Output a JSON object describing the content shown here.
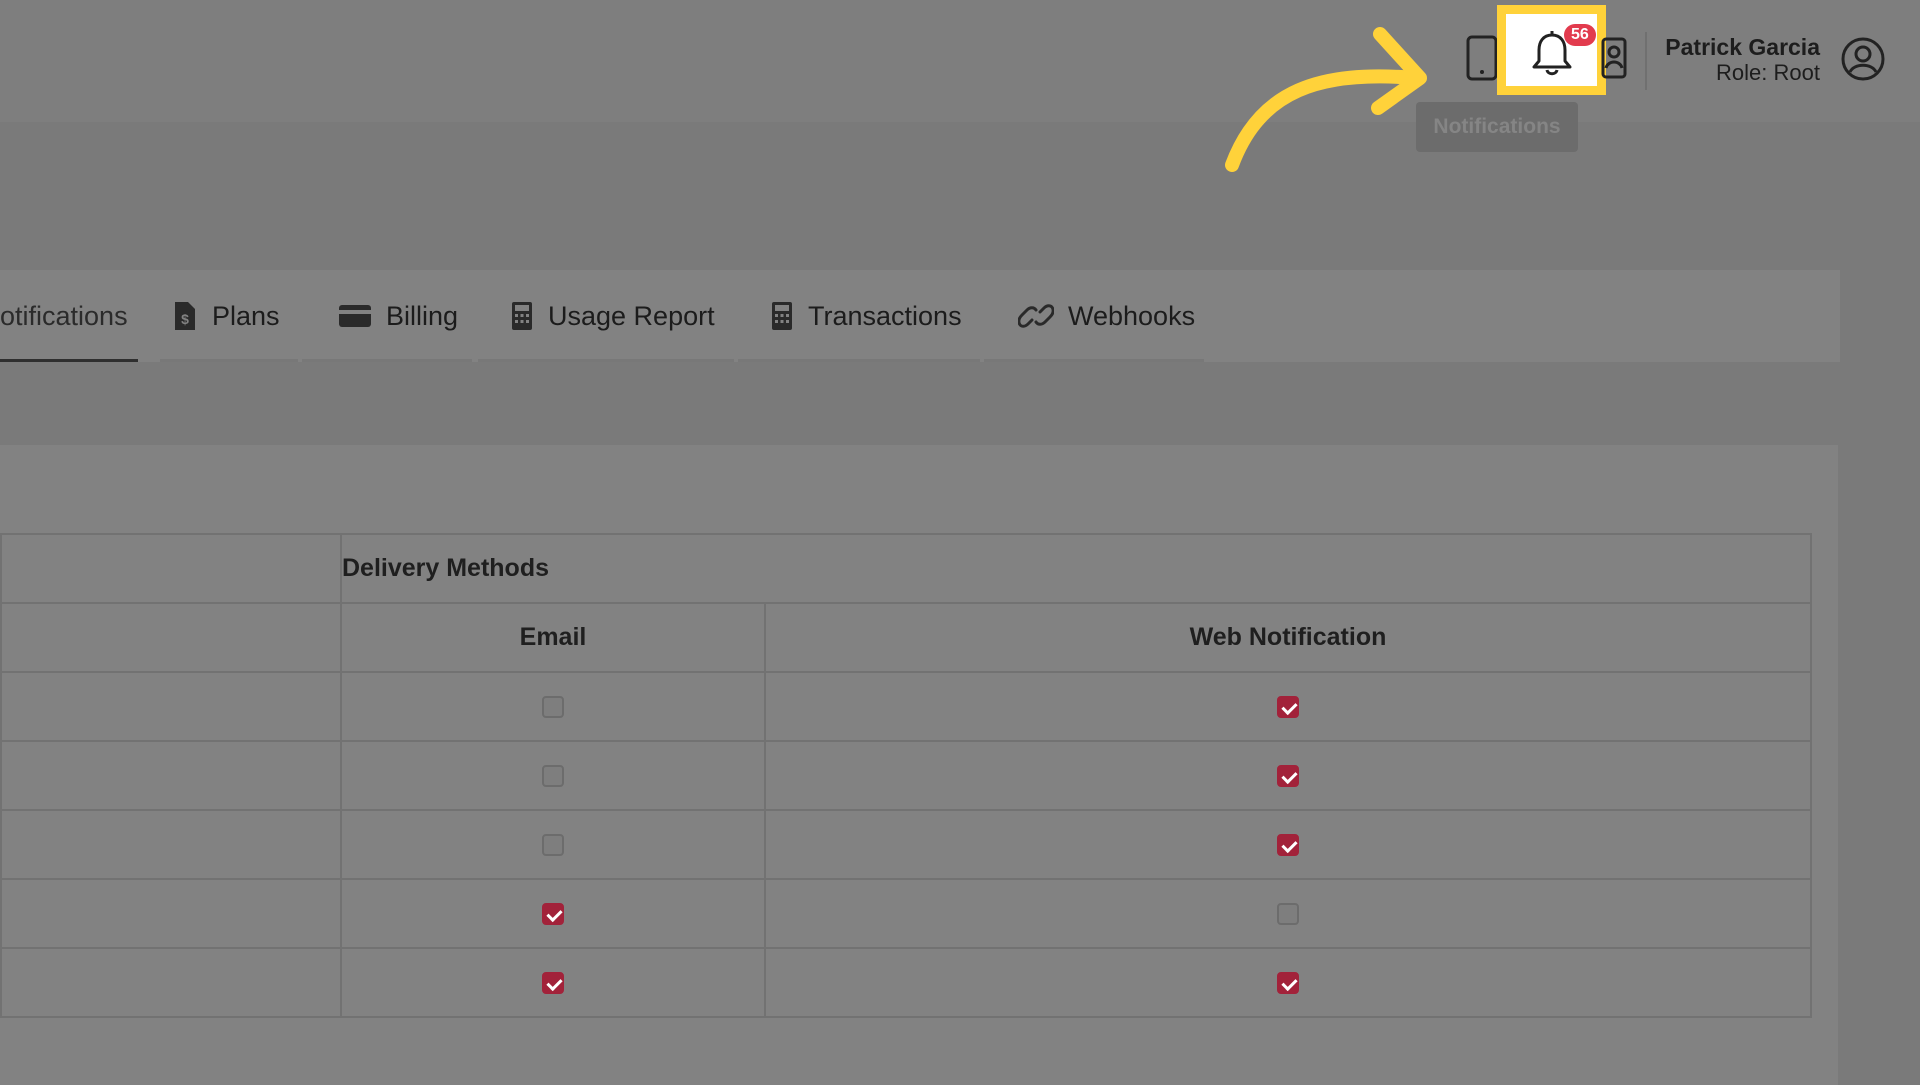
{
  "header": {
    "user_name": "Patrick Garcia",
    "user_role": "Role: Root",
    "notification_count": "56",
    "tooltip": "Notifications",
    "icons": [
      "phone-icon",
      "bell-icon",
      "contact-card-icon",
      "user-avatar-icon"
    ],
    "highlight_color": "#ffd23a",
    "badge_color": "#e23b4e",
    "annotation_arrow_color": "#ffd23a"
  },
  "tabs": [
    {
      "label": "otifications",
      "icon": "none",
      "active": true
    },
    {
      "label": "Plans",
      "icon": "dollar-file-icon",
      "active": false
    },
    {
      "label": "Billing",
      "icon": "credit-card-icon",
      "active": false
    },
    {
      "label": "Usage Report",
      "icon": "calculator-icon",
      "active": false
    },
    {
      "label": "Transactions",
      "icon": "calculator-icon",
      "active": false
    },
    {
      "label": "Webhooks",
      "icon": "link-icon",
      "active": false
    }
  ],
  "table": {
    "group_header": "Delivery Methods",
    "columns": [
      "Email",
      "Web Notification"
    ],
    "rows": [
      {
        "email": false,
        "web": true
      },
      {
        "email": false,
        "web": true
      },
      {
        "email": false,
        "web": true
      },
      {
        "email": true,
        "web": false
      },
      {
        "email": true,
        "web": true
      }
    ],
    "checked_color": "#a2223a"
  }
}
